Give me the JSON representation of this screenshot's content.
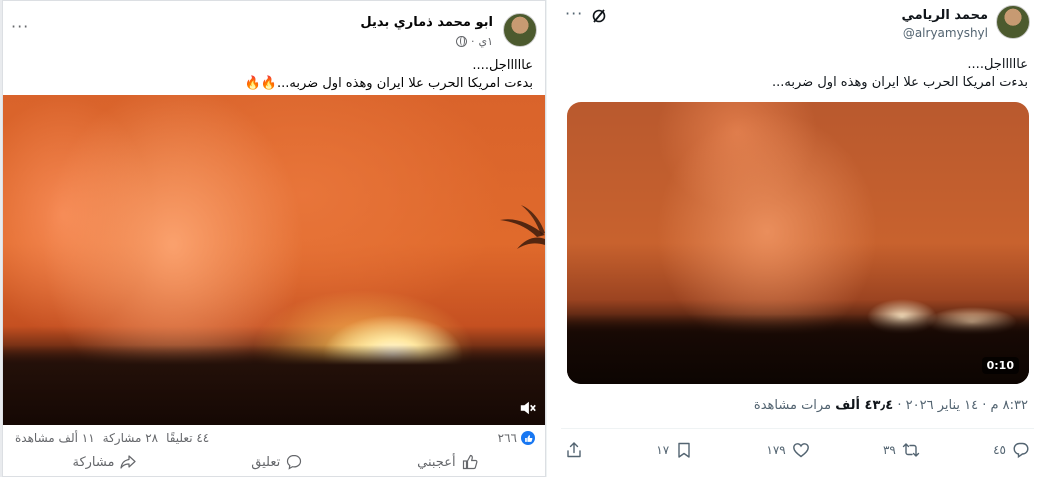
{
  "facebook": {
    "author_name": "ابو محمد ذماري بديل",
    "time": "١ي",
    "separator": "·",
    "more": "···",
    "text_line1": "عاااااجل....",
    "text_line2": "بدءت امريكا الحرب علا ايران وهذه اول ضربه...🔥🔥",
    "likes_count": "٢٦٦",
    "comments_stat": "٤٤ تعليقًا",
    "shares_stat": "٢٨ مشاركة",
    "views_stat": "١١ ألف مشاهدة",
    "action_like": "أعجبني",
    "action_comment": "تعليق",
    "action_share": "مشاركة",
    "like_color": "#1877f2"
  },
  "twitter": {
    "author_name": "محمد الريامي",
    "handle": "@alryamyshyl",
    "more": "···",
    "text_line1": "عاااااجل....",
    "text_line2": "بدءت امريكا الحرب علا ايران وهذه اول ضربه...",
    "video_duration": "0:10",
    "meta_time": "٨:٣٢ م · ١٤ يناير ٢٠٢٦ · ",
    "meta_views_value": "٤٣٫٤ ألف",
    "meta_views_label": " مرات مشاهدة",
    "replies": "٤٥",
    "retweets": "٣٩",
    "likes": "١٧٩",
    "bookmarks": "١٧"
  }
}
